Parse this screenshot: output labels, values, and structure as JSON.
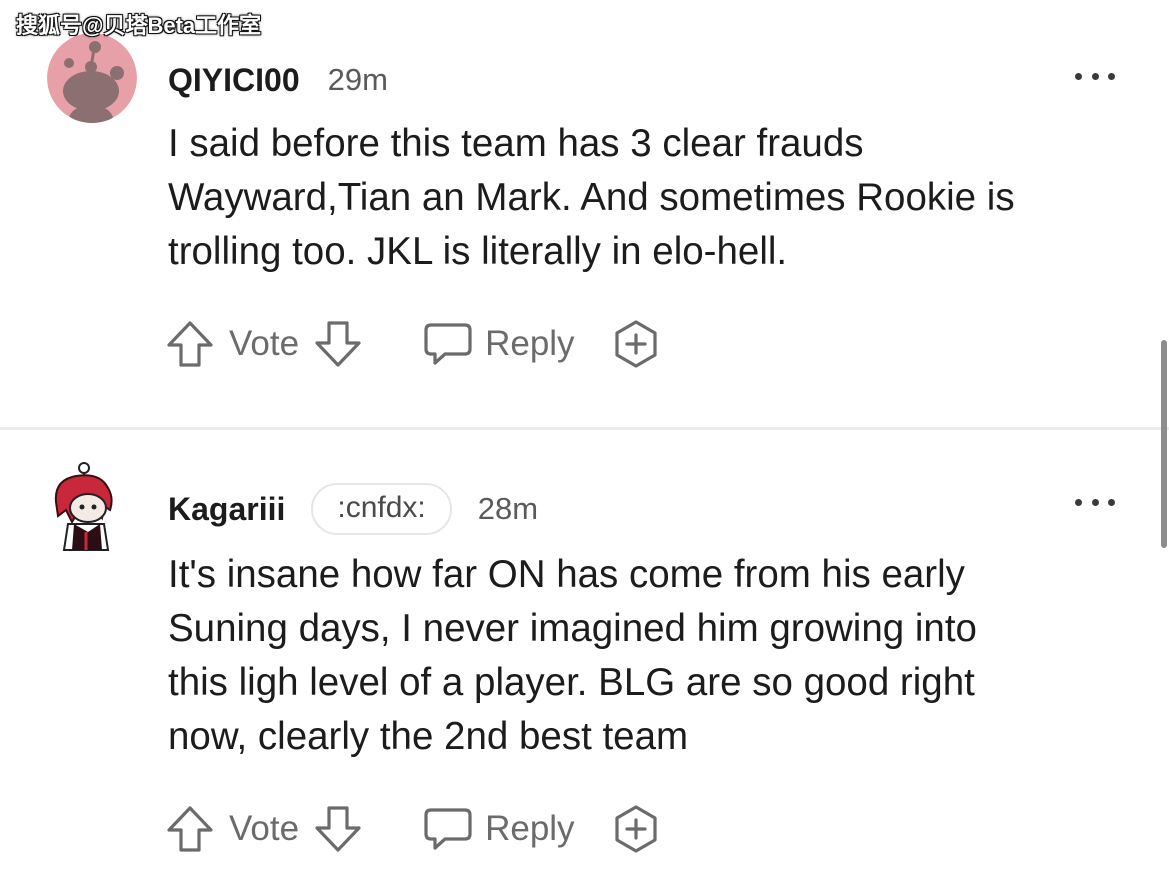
{
  "watermark": "搜狐号@贝塔Beta工作室",
  "comments": [
    {
      "username": "QIYICI00",
      "flair": "",
      "time": "29m",
      "lines": [
        "I said before this team has 3 clear frauds",
        "Wayward,Tian an Mark. And sometimes Rookie is",
        "trolling too. JKL is literally in elo-hell."
      ],
      "vote_label": "Vote",
      "reply_label": "Reply"
    },
    {
      "username": "Kagariii",
      "flair": ":cnfdx:",
      "time": "28m",
      "lines": [
        "It's insane how far ON has come from his early",
        "Suning days, I never imagined him growing into",
        "this ligh level of a player. BLG are so good right",
        "now, clearly the 2nd best team"
      ],
      "vote_label": "Vote",
      "reply_label": "Reply"
    }
  ],
  "colors": {
    "avatar_bg": "#e8a0a8",
    "text": "#1c1c1c",
    "muted": "#6b6b6b",
    "divider": "#ececec"
  }
}
